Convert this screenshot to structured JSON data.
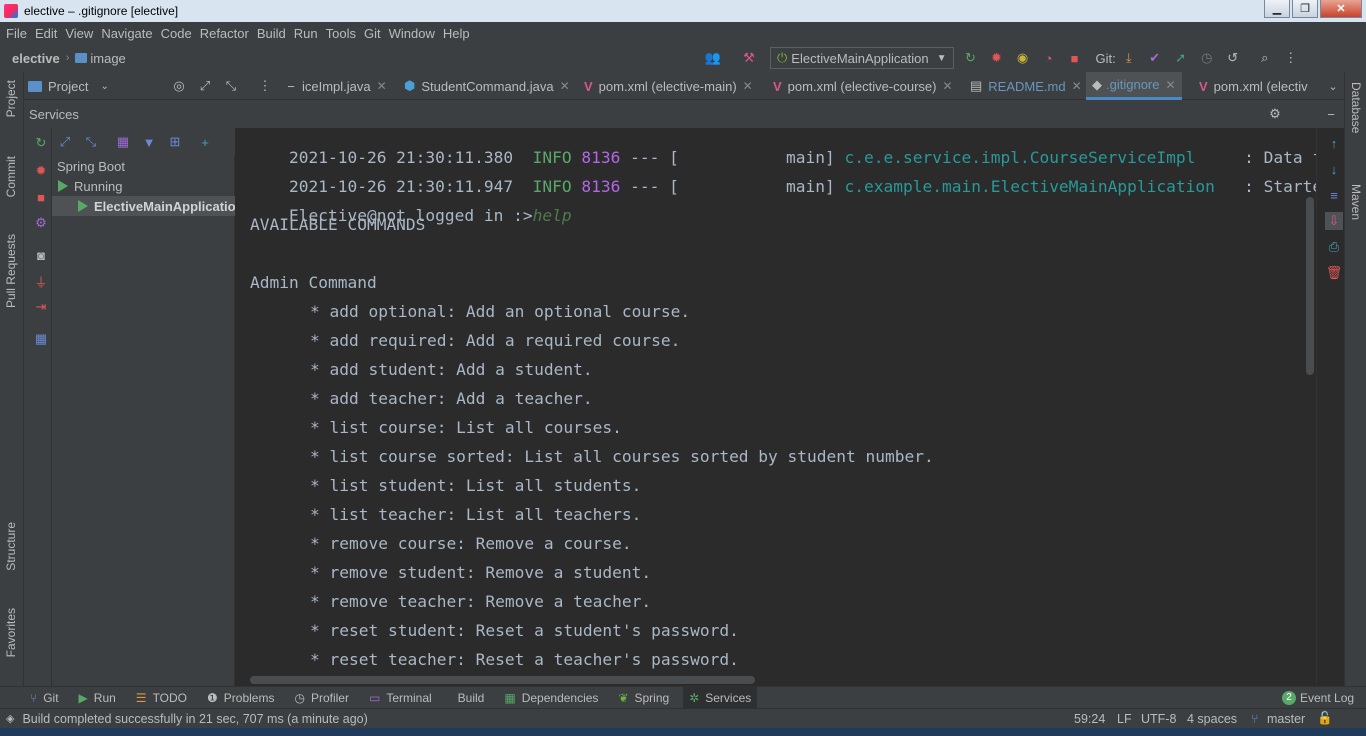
{
  "window": {
    "title": "elective – .gitignore [elective]"
  },
  "menu": [
    "File",
    "Edit",
    "View",
    "Navigate",
    "Code",
    "Refactor",
    "Build",
    "Run",
    "Tools",
    "Git",
    "Window",
    "Help"
  ],
  "breadcrumb": {
    "project": "elective",
    "folder": "image"
  },
  "run_config": "ElectiveMainApplication",
  "git_label": "Git:",
  "project_button": "Project",
  "tabs": [
    {
      "label": "iceImpl.java"
    },
    {
      "label": "StudentCommand.java"
    },
    {
      "label": "pom.xml (elective-main)"
    },
    {
      "label": "pom.xml (elective-course)"
    },
    {
      "label": "README.md"
    },
    {
      "label": ".gitignore"
    },
    {
      "label": "pom.xml (electiv"
    }
  ],
  "left_stripe": {
    "project": "Project",
    "commit": "Commit",
    "pull_requests": "Pull Requests",
    "structure": "Structure",
    "favorites": "Favorites"
  },
  "right_stripe": {
    "database": "Database",
    "maven": "Maven"
  },
  "services": {
    "title": "Services",
    "tree": {
      "root": "Spring Boot",
      "group": "Running",
      "app": "ElectiveMainApplicatio"
    }
  },
  "console": {
    "log1": {
      "timestamp": "2021-10-26 21:30:11.380",
      "level": "INFO",
      "pid": "8136",
      "dashes": "--- [",
      "thread": "main]",
      "logger": "c.e.e.service.impl.CourseServiceImpl",
      "message": ": Data fi"
    },
    "log2": {
      "timestamp": "2021-10-26 21:30:11.947",
      "level": "INFO",
      "pid": "8136",
      "dashes": "--- [",
      "thread": "main]",
      "logger": "c.example.main.ElectiveMainApplication",
      "message": ": Startec"
    },
    "prompt": "Elective@not logged in :>",
    "input": "help",
    "heading": "AVAILABLE COMMANDS",
    "section": "Admin Command",
    "commands": [
      "* add optional: Add an optional course.",
      "* add required: Add a required course.",
      "* add student: Add a student.",
      "* add teacher: Add a teacher.",
      "* list course: List all courses.",
      "* list course sorted: List all courses sorted by student number.",
      "* list student: List all students.",
      "* list teacher: List all teachers.",
      "* remove course: Remove a course.",
      "* remove student: Remove a student.",
      "* remove teacher: Remove a teacher.",
      "* reset student: Reset a student's password.",
      "* reset teacher: Reset a teacher's password."
    ]
  },
  "bottom_tools": [
    "Git",
    "Run",
    "TODO",
    "Problems",
    "Profiler",
    "Terminal",
    "Build",
    "Dependencies",
    "Spring",
    "Services"
  ],
  "event_log": {
    "count": "2",
    "label": "Event Log"
  },
  "status": {
    "message": "Build completed successfully in 21 sec, 707 ms (a minute ago)",
    "position": "59:24",
    "line_sep": "LF",
    "encoding": "UTF-8",
    "indent": "4 spaces",
    "branch": "master"
  },
  "colors": {
    "accent": "#4a88c7",
    "info": "#59a869",
    "pid": "#b267e6",
    "logger": "#299999",
    "background": "#2b2b2b",
    "panel": "#3c3f41"
  }
}
